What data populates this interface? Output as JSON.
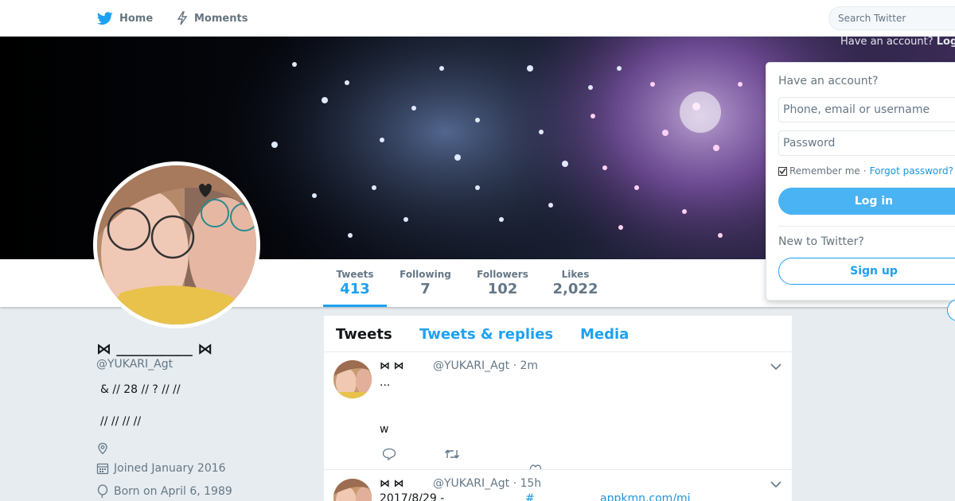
{
  "nav": {
    "home_label": "Home",
    "moments_label": "Moments",
    "search_placeholder": "Search Twitter"
  },
  "profile": {
    "display_name": "⋈ ＿＿＿＿＿ ⋈",
    "handle": "@YUKARI_Agt",
    "bio_line1": "&   // 28 // ? //  //",
    "bio_line2": "//  //  //  //",
    "joined": "Joined January 2016",
    "born": "Born on April 6, 1989"
  },
  "stats": [
    {
      "label": "Tweets",
      "value": "413"
    },
    {
      "label": "Following",
      "value": "7"
    },
    {
      "label": "Followers",
      "value": "102"
    },
    {
      "label": "Likes",
      "value": "2,022"
    }
  ],
  "timeline": {
    "tabs": [
      "Tweets",
      "Tweets & replies",
      "Media"
    ],
    "tweets": [
      {
        "name": "⋈   ⋈",
        "handle_time": "@YUKARI_Agt · 2m",
        "line1": "...",
        "line2": "w"
      },
      {
        "name": "⋈   ⋈",
        "handle_time": "@YUKARI_Agt · 15h",
        "line1": "2017/8/29 -",
        "hashtag": "#",
        "link": "appkmn.com/mi"
      }
    ]
  },
  "login": {
    "hint": "Have an account?",
    "hint_link": "Log",
    "title": "Have an account?",
    "username_placeholder": "Phone, email or username",
    "password_placeholder": "Password",
    "remember": "Remember me",
    "separator": "·",
    "forgot": "Forgot password?",
    "login_button": "Log in",
    "new_prompt": "New to Twitter?",
    "signup_button": "Sign up"
  },
  "colors": {
    "accent": "#1da1f2",
    "login_button": "#4ab3f4",
    "page_bg": "#e6ecf0"
  }
}
